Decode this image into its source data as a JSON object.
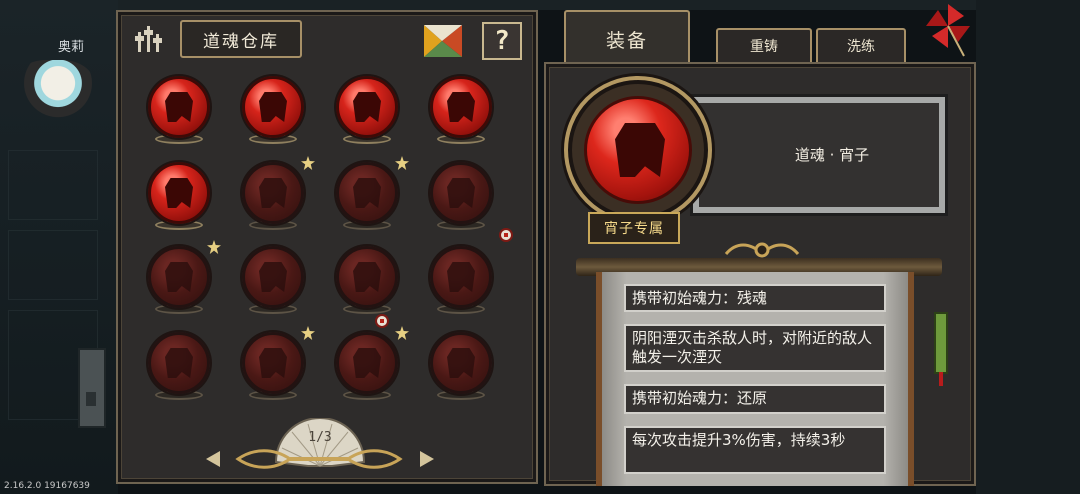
{
  "background": {
    "npc_name": "奥莉",
    "version": "2.16.2.0 19167639"
  },
  "storage": {
    "title": "道魂仓库",
    "tuning_icon": "tuning-sliders-icon",
    "tangram_icon": "tangram-icon",
    "help_label": "?",
    "page": "1/3",
    "souls": [
      {
        "state": "owned",
        "star": false,
        "dot": false
      },
      {
        "state": "owned",
        "star": false,
        "dot": false
      },
      {
        "state": "owned",
        "star": false,
        "dot": false
      },
      {
        "state": "owned",
        "star": false,
        "dot": false
      },
      {
        "state": "owned",
        "star": false,
        "dot": false
      },
      {
        "state": "locked",
        "star": true,
        "dot": false
      },
      {
        "state": "locked",
        "star": true,
        "dot": false
      },
      {
        "state": "locked",
        "star": false,
        "dot": true
      },
      {
        "state": "locked",
        "star": true,
        "dot": false
      },
      {
        "state": "locked",
        "star": false,
        "dot": false
      },
      {
        "state": "locked",
        "star": false,
        "dot": true
      },
      {
        "state": "locked",
        "star": false,
        "dot": false
      },
      {
        "state": "locked",
        "star": false,
        "dot": false
      },
      {
        "state": "locked",
        "star": true,
        "dot": false
      },
      {
        "state": "locked",
        "star": true,
        "dot": false
      },
      {
        "state": "locked",
        "star": false,
        "dot": false
      }
    ]
  },
  "tabs": {
    "equip": "装备",
    "reforge": "重铸",
    "refine": "洗练"
  },
  "detail": {
    "name": "道魂 · 宵子",
    "exclusive_tag": "宵子专属",
    "lines": [
      "携带初始魂力：残魂",
      "阴阳湮灭击杀敌人时，对附近的敌人触发一次湮灭",
      "携带初始魂力：还原",
      "每次攻击提升3%伤害，持续3秒"
    ]
  },
  "colors": {
    "orb_red": "#d6241b",
    "gold_frame": "#a79067",
    "panel_bg": "#2e2c2b"
  }
}
